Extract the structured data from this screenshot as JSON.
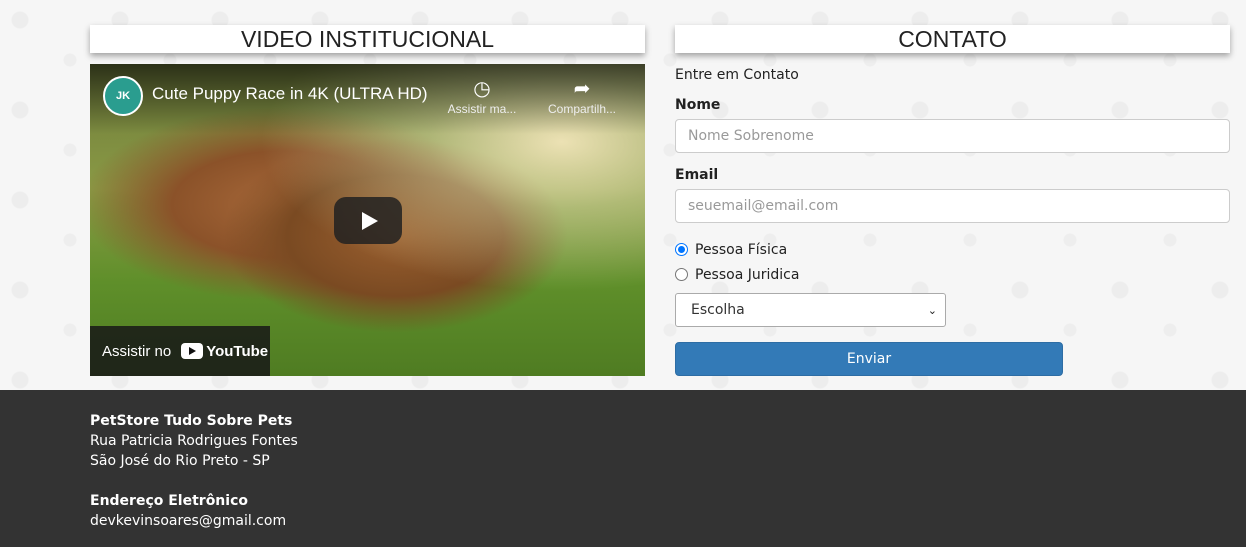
{
  "sections": {
    "video_title": "VIDEO INSTITUCIONAL",
    "contact_title": "CONTATO"
  },
  "video": {
    "channel_avatar_text": "JK",
    "title": "Cute Puppy Race in 4K (ULTRA HD)",
    "watch_later_label": "Assistir ma...",
    "share_label": "Compartilh...",
    "watch_on_label": "Assistir no",
    "youtube_label": "YouTube"
  },
  "form": {
    "intro": "Entre em Contato",
    "name_label": "Nome",
    "name_placeholder": "Nome Sobrenome",
    "email_label": "Email",
    "email_placeholder": "seuemail@email.com",
    "radio_options": [
      "Pessoa Física",
      "Pessoa Juridica"
    ],
    "radio_selected": "Pessoa Física",
    "select_value": "Escolha",
    "submit_label": "Enviar"
  },
  "footer": {
    "company": "PetStore Tudo Sobre Pets",
    "address_line1": "Rua Patricia Rodrigues Fontes",
    "address_line2": "São José do Rio Preto - SP",
    "email_heading": "Endereço Eletrônico",
    "email": "devkevinsoares@gmail.com"
  },
  "colors": {
    "primary_button": "#337ab7",
    "footer_bg": "#333333",
    "radio_accent": "#0075ff"
  }
}
